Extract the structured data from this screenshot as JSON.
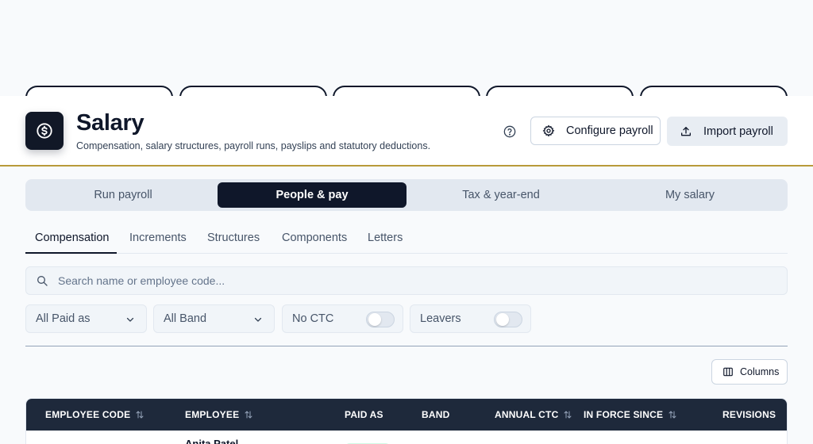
{
  "header": {
    "title": "Salary",
    "subtitle": "Compensation, salary structures, payroll runs, payslips and statutory deductions.",
    "icon": "dollar-circle-icon",
    "actions": {
      "configure_label": "Configure payroll",
      "import_label": "Import payroll"
    }
  },
  "segments": [
    {
      "label": "Run payroll",
      "active": false
    },
    {
      "label": "People & pay",
      "active": true
    },
    {
      "label": "Tax & year-end",
      "active": false
    },
    {
      "label": "My salary",
      "active": false
    }
  ],
  "subtabs": [
    {
      "label": "Compensation",
      "active": true
    },
    {
      "label": "Increments",
      "active": false
    },
    {
      "label": "Structures",
      "active": false
    },
    {
      "label": "Components",
      "active": false
    },
    {
      "label": "Letters",
      "active": false
    }
  ],
  "search": {
    "placeholder": "Search name or employee code..."
  },
  "filters": {
    "paid_as": "All Paid as",
    "band": "All Band",
    "no_ctc_label": "No CTC",
    "no_ctc_on": false,
    "leavers_label": "Leavers",
    "leavers_on": false
  },
  "columns_button": "Columns",
  "table": {
    "headers": [
      "EMPLOYEE CODE",
      "EMPLOYEE",
      "PAID AS",
      "BAND",
      "ANNUAL CTC",
      "IN FORCE SINCE",
      "REVISIONS"
    ],
    "rows": [
      {
        "employee": "Anita Patel"
      }
    ]
  },
  "colors": {
    "accent_dark": "#0f172a",
    "header_rule": "#b89a3a",
    "table_head": "#1e293b"
  }
}
